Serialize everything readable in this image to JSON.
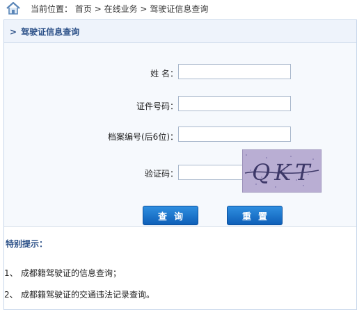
{
  "breadcrumb": {
    "prefix": "当前位置：",
    "items": [
      "首页",
      "在线业务",
      "驾驶证信息查询"
    ],
    "separator": ">"
  },
  "panel": {
    "marker": ">",
    "title": "驾驶证信息查询"
  },
  "form": {
    "name_label": "姓 名：",
    "id_label": "证件号码：",
    "file_label": "档案编号(后6位)：",
    "captcha_label": "验证码：",
    "captcha_text": "QKT"
  },
  "buttons": {
    "query": "查询",
    "reset": "重置"
  },
  "tips": {
    "title": "特别提示：",
    "items": [
      {
        "num": "1、",
        "text": "成都籍驾驶证的信息查询；"
      },
      {
        "num": "2、",
        "text": "成都籍驾驶证的交通违法记录查询。"
      }
    ]
  },
  "colors": {
    "accent": "#2a4f87",
    "button": "#1a72cc",
    "panel_bg": "#f6f9fd",
    "border": "#c6d6ea"
  }
}
